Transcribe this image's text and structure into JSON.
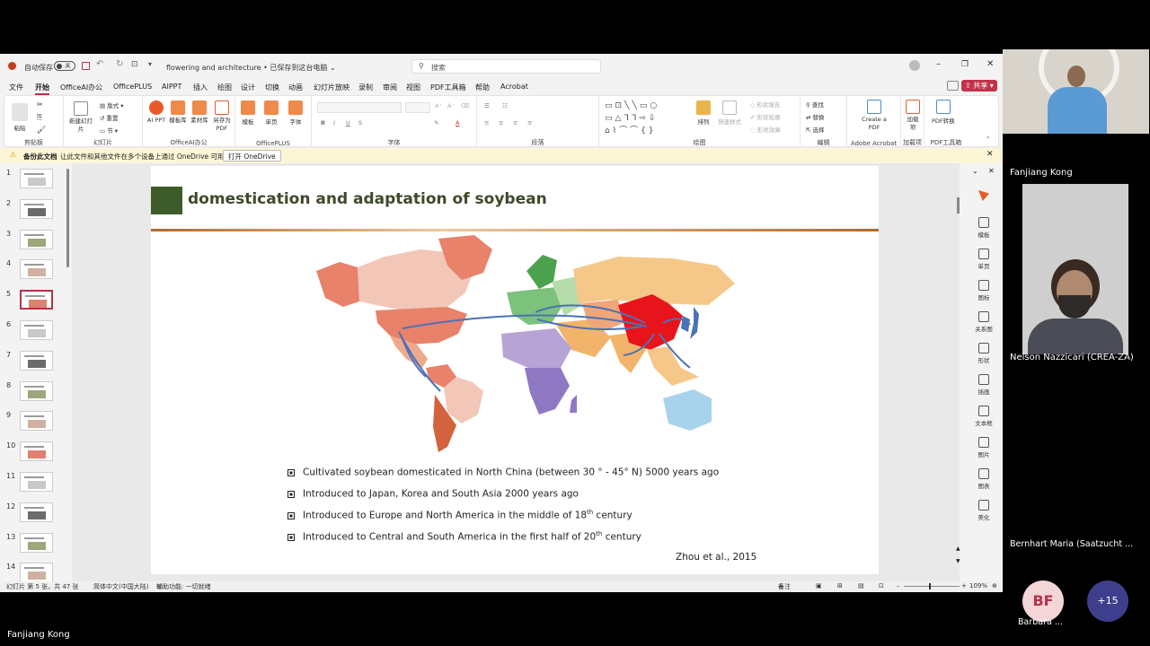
{
  "titlebar": {
    "autosave": "自动保存",
    "toggle": "关",
    "doc_title": "flowering and architecture • 已保存到这台电脑",
    "search_placeholder": "搜索"
  },
  "menu": {
    "items": [
      "文件",
      "开始",
      "OfficeAI办公",
      "OfficePLUS",
      "AIPPT",
      "插入",
      "绘图",
      "设计",
      "切换",
      "动画",
      "幻灯片放映",
      "录制",
      "审阅",
      "视图",
      "PDF工具箱",
      "帮助",
      "Acrobat"
    ],
    "active": "开始",
    "share": "共享"
  },
  "ribbon": {
    "clipboard": {
      "paste": "粘贴",
      "label": "剪贴板"
    },
    "slides": {
      "new": "新建幻灯片",
      "layout": "版式",
      "reset": "重置",
      "section": "节",
      "label": "幻灯片"
    },
    "officeai": {
      "aippt": "AI PPT",
      "template": "模板库",
      "material": "素材库",
      "saveas": "另存为PDF",
      "label": "OfficeAI办公"
    },
    "officeplus": {
      "template": "模板",
      "single": "单页",
      "font": "字体",
      "label": "OfficePLUS"
    },
    "font": {
      "label": "字体"
    },
    "paragraph": {
      "label": "段落"
    },
    "drawing": {
      "arrange": "排列",
      "quickstyle": "快速样式",
      "fill": "形状填充",
      "outline": "形状轮廓",
      "effect": "形状效果",
      "label": "绘图"
    },
    "edit": {
      "find": "查找",
      "replace": "替换",
      "select": "选择",
      "label": "编辑"
    },
    "acrobat": {
      "create": "Create a PDF",
      "label": "Adobe Acrobat"
    },
    "addins": {
      "load": "加载项",
      "label": "加载项"
    },
    "pdftools": {
      "convert": "PDF转换",
      "label": "PDF工具箱"
    }
  },
  "notification": {
    "title": "备份此文档",
    "text": "让此文件和其他文件在多个设备上通过 OneDrive 可用。",
    "button": "打开 OneDrive"
  },
  "thumbnails": [
    "1",
    "2",
    "3",
    "4",
    "5",
    "6",
    "7",
    "8",
    "9",
    "10",
    "11",
    "12",
    "13",
    "14"
  ],
  "selected_slide": "5",
  "right_panel": [
    "模板",
    "单页",
    "图标",
    "关系图",
    "形状",
    "插画",
    "文本框",
    "图片",
    "图表",
    "美化"
  ],
  "slide": {
    "title": "domestication and adaptation of soybean",
    "bullets": [
      {
        "pre": "Cultivated soybean domesticated in North China (between 30 ° - 45° N) 5000 years ago",
        "sup": "",
        "post": ""
      },
      {
        "pre": "Introduced to Japan, Korea and South Asia 2000 years ago",
        "sup": "",
        "post": ""
      },
      {
        "pre": "Introduced to Europe and North America in the middle of 18",
        "sup": "th",
        "post": " century"
      },
      {
        "pre": "Introduced to Central and South America in the first half of 20",
        "sup": "th",
        "post": " century"
      }
    ],
    "citation": "Zhou et al., 2015",
    "colors": {
      "title_box": "#3d5c2a",
      "rule": "#b06a2a",
      "china": "#e8141b",
      "arrow": "#4a72b8"
    }
  },
  "status": {
    "slide_info": "幻灯片 第 5 张，共 47 张",
    "language": "简体中文(中国大陆)",
    "accessibility": "辅助功能: 一切就绪",
    "notes": "备注",
    "zoom": "109%"
  },
  "meeting": {
    "participants": [
      {
        "name": "Fanjiang Kong"
      },
      {
        "name": "Nelson Nazzicari (CREA-ZA)"
      },
      {
        "name": "Bernhart Maria (Saatzucht ..."
      },
      {
        "initials": "BF",
        "name": "Barbara ..."
      }
    ],
    "more": "+15",
    "presenter": "Fanjiang Kong"
  }
}
